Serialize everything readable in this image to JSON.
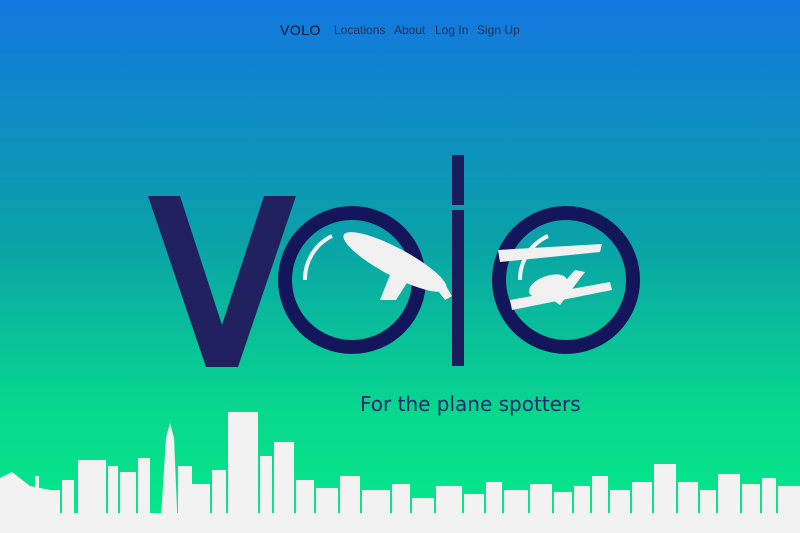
{
  "nav": {
    "brand": "VOLO",
    "links": [
      "Locations",
      "About",
      "Log In",
      "Sign Up"
    ]
  },
  "hero": {
    "tagline": "For the plane spotters",
    "logo_icon": "volo-airplane-logo"
  },
  "colors": {
    "gradient_top": "#1377e0",
    "gradient_bottom": "#05e98a",
    "logo": "#1a1f5e",
    "skyline": "#f2f2f2"
  }
}
